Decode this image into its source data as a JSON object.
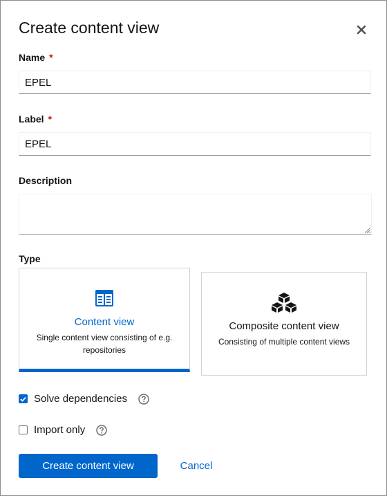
{
  "modal": {
    "title": "Create content view"
  },
  "form": {
    "name": {
      "label": "Name",
      "required_marker": "*",
      "value": "EPEL"
    },
    "label": {
      "label": "Label",
      "required_marker": "*",
      "value": "EPEL"
    },
    "description": {
      "label": "Description",
      "value": ""
    },
    "type": {
      "label": "Type",
      "options": [
        {
          "title": "Content view",
          "description": "Single content view consisting of e.g. repositories",
          "icon": "content-view-icon",
          "selected": true
        },
        {
          "title": "Composite content view",
          "description": "Consisting of multiple content views",
          "icon": "composite-content-view-icon",
          "selected": false
        }
      ]
    },
    "solve_dependencies": {
      "label": "Solve dependencies",
      "checked": true,
      "help_icon": "help-icon"
    },
    "import_only": {
      "label": "Import only",
      "checked": false,
      "help_icon": "help-icon"
    }
  },
  "actions": {
    "submit_label": "Create content view",
    "cancel_label": "Cancel"
  },
  "colors": {
    "primary": "#0066cc",
    "required": "#c9190b",
    "text": "#151515"
  }
}
